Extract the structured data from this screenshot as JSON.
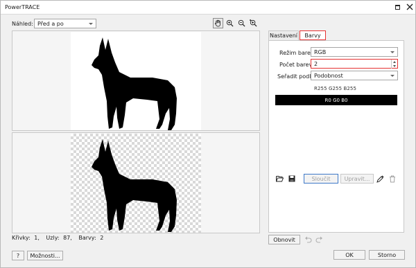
{
  "window": {
    "title": "PowerTRACE"
  },
  "toolbar": {
    "preview_label": "Náhled:",
    "preview_value": "Před a po"
  },
  "stats": {
    "curves_label": "Křivky:",
    "curves_value": "1,",
    "nodes_label": "Uzly:",
    "nodes_value": "87,",
    "colors_label": "Barvy:",
    "colors_value": "2"
  },
  "tabs": {
    "settings": "Nastavení",
    "colors": "Barvy"
  },
  "colors_panel": {
    "mode_label": "Režim barev:",
    "mode_value": "RGB",
    "count_label": "Počet barev:",
    "count_value": "2",
    "sort_label": "Seřadit podle:",
    "sort_value": "Podobnost",
    "swatch_white": "R255 G255 B255",
    "swatch_black": "R0 G0 B0",
    "merge_button": "Sloučit",
    "edit_button": "Upravit..."
  },
  "footer": {
    "help_button": "?",
    "options_button": "Možnosti...",
    "restore_button": "Obnovit",
    "ok_button": "OK",
    "cancel_button": "Storno"
  },
  "colors": {
    "accent_red": "#e53030",
    "focus_blue": "#3c78c8"
  },
  "icons": [
    "pan-hand-icon",
    "zoom-in-icon",
    "zoom-out-icon",
    "zoom-fit-icon",
    "folder-open-icon",
    "save-icon",
    "eyedropper-icon",
    "trash-icon",
    "undo-icon",
    "redo-icon",
    "maximize-icon",
    "close-icon"
  ]
}
